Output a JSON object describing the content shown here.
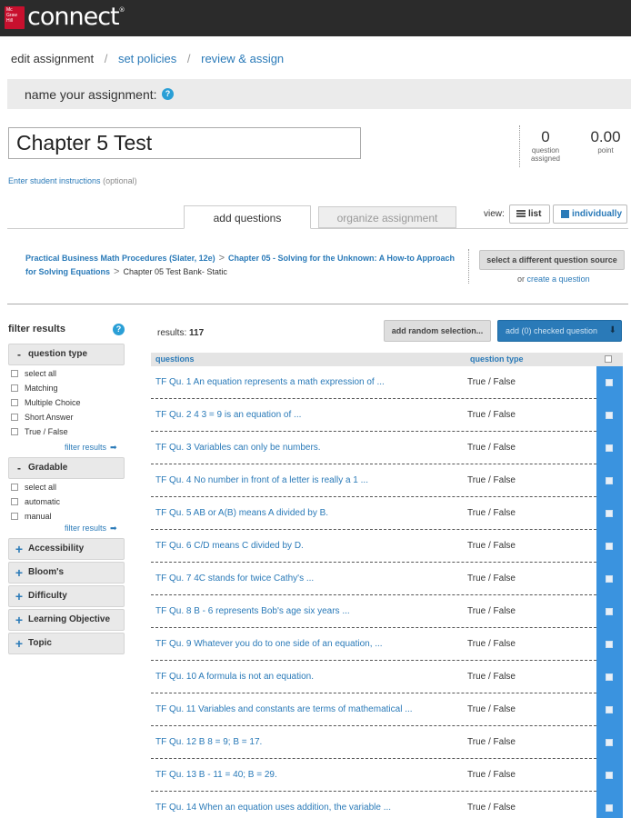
{
  "brand": {
    "logo_text": "Mc Graw Hill Education",
    "name": "connect",
    "mark": "®"
  },
  "steps": {
    "current": "edit assignment",
    "policies": "set policies",
    "review": "review & assign",
    "sep": "/"
  },
  "namebar": {
    "label": "name your assignment:",
    "help": "?"
  },
  "assignment": {
    "title": "Chapter 5 Test"
  },
  "stats": {
    "questions_num": "0",
    "questions_lbl1": "question",
    "questions_lbl2": "assigned",
    "points_num": "0.00",
    "points_lbl": "point"
  },
  "instructions": {
    "link": "Enter student instructions",
    "optional": "(optional)"
  },
  "tabs": {
    "add": "add questions",
    "organize": "organize assignment"
  },
  "view": {
    "label": "view:",
    "list": "list",
    "individually": "individually"
  },
  "source": {
    "book": "Practical Business Math Procedures (Slater, 12e)",
    "chapter": "Chapter 05 - Solving for the Unknown: A How-to Approach for Solving Equations",
    "bank": "Chapter 05 Test Bank- Static",
    "sep": ">",
    "change_btn": "select a different question source",
    "or": "or",
    "create": "create a question"
  },
  "filters": {
    "title": "filter results",
    "help": "?",
    "question_type": {
      "label": "question type",
      "options": [
        "select all",
        "Matching",
        "Multiple Choice",
        "Short Answer",
        "True / False"
      ]
    },
    "gradable": {
      "label": "Gradable",
      "options": [
        "select all",
        "automatic",
        "manual"
      ]
    },
    "filter_link": "filter results",
    "collapsed": [
      "Accessibility",
      "Bloom's",
      "Difficulty",
      "Learning Objective",
      "Topic"
    ],
    "minus": "-",
    "plus": "+"
  },
  "results": {
    "label": "results:",
    "count": "117",
    "random_btn": "add random selection...",
    "add_btn": "add (0) checked question"
  },
  "table": {
    "col_questions": "questions",
    "col_type": "question type",
    "rows": [
      {
        "q": "TF Qu. 1 An equation represents a math expression of ...",
        "t": "True / False"
      },
      {
        "q": "TF Qu. 2 4 3 = 9 is an equation of ...",
        "t": "True / False"
      },
      {
        "q": "TF Qu. 3 Variables can only be numbers.",
        "t": "True / False"
      },
      {
        "q": "TF Qu. 4 No number in front of a letter is really a 1 ...",
        "t": "True / False"
      },
      {
        "q": "TF Qu. 5 AB or A(B) means A divided by B.",
        "t": "True / False"
      },
      {
        "q": "TF Qu. 6 C/D means C divided by D.",
        "t": "True / False"
      },
      {
        "q": "TF Qu. 7 4C stands for twice Cathy's ...",
        "t": "True / False"
      },
      {
        "q": "TF Qu. 8 B - 6 represents Bob's age six years ...",
        "t": "True / False"
      },
      {
        "q": "TF Qu. 9 Whatever you do to one side of an equation, ...",
        "t": "True / False"
      },
      {
        "q": "TF Qu. 10 A formula is not an equation.",
        "t": "True / False"
      },
      {
        "q": "TF Qu. 11 Variables and constants are terms of mathematical ...",
        "t": "True / False"
      },
      {
        "q": "TF Qu. 12 B 8 = 9; B = 17.",
        "t": "True / False"
      },
      {
        "q": "TF Qu. 13 B - 11 = 40; B = 29.",
        "t": "True / False"
      },
      {
        "q": "TF Qu. 14 When an equation uses addition, the variable ...",
        "t": "True / False"
      }
    ]
  },
  "colors": {
    "accent": "#2a7ab8",
    "brand_red": "#c8102e",
    "topbar": "#2b2b2b",
    "select_col": "#3a93df"
  }
}
